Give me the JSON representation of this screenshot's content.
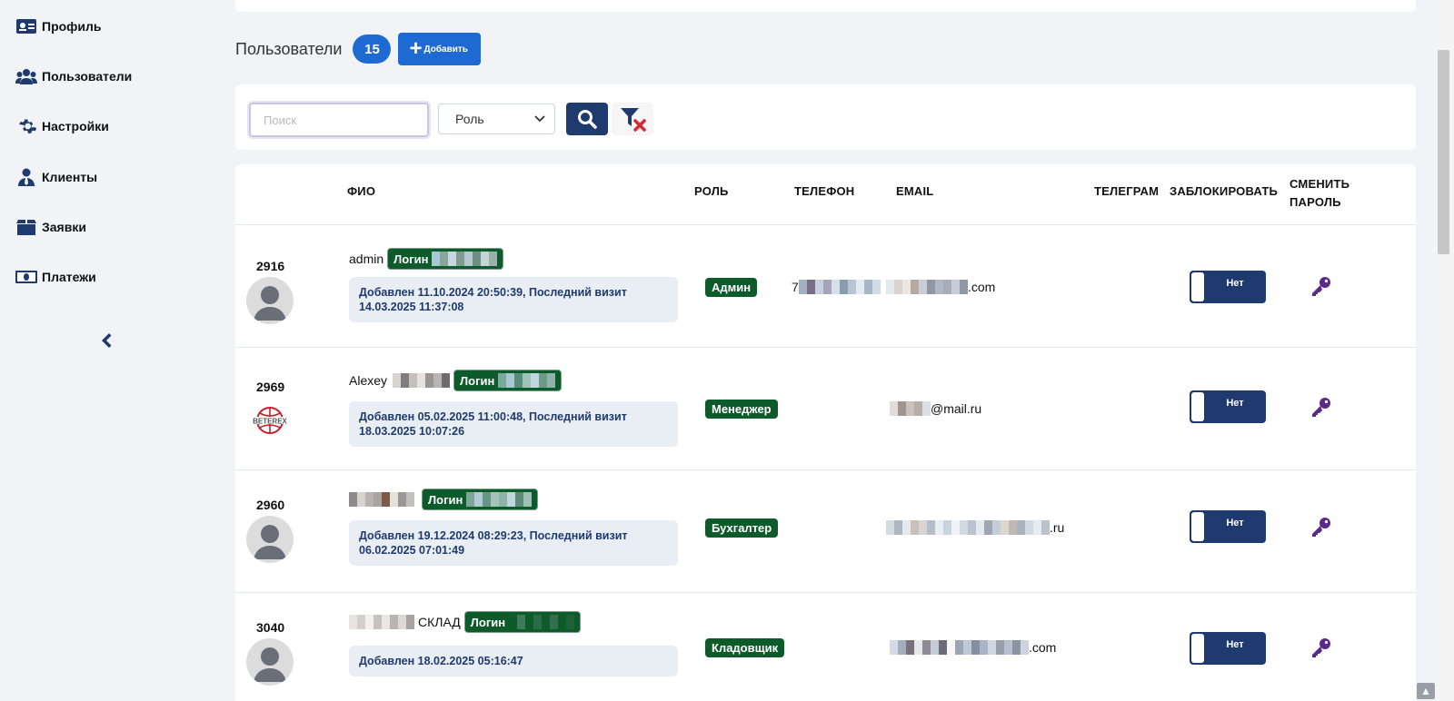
{
  "sidebar": {
    "items": [
      {
        "label": "Профиль",
        "icon": "id-card-icon"
      },
      {
        "label": "Пользователи",
        "icon": "users-icon"
      },
      {
        "label": "Настройки",
        "icon": "gear-icon"
      },
      {
        "label": "Клиенты",
        "icon": "user-tie-icon"
      },
      {
        "label": "Заявки",
        "icon": "box-icon"
      },
      {
        "label": "Платежи",
        "icon": "money-bill-icon"
      }
    ],
    "collapse_icon": "chevron-left-icon"
  },
  "header": {
    "title": "Пользователи",
    "count": "15",
    "add_label": "Добавить"
  },
  "filters": {
    "search_placeholder": "Поиск",
    "role_selected": "Роль"
  },
  "table": {
    "columns": {
      "fio": "ФИО",
      "role": "РОЛЬ",
      "phone": "ТЕЛЕФОН",
      "email": "EMAIL",
      "telegram": "ТЕЛЕГРАМ",
      "block": "ЗАБЛОКИРОВАТЬ",
      "change_password_1": "СМЕНИТЬ",
      "change_password_2": "ПАРОЛЬ"
    },
    "rows": [
      {
        "id": "2916",
        "name": "admin",
        "login_label": "Логин",
        "info_line1": "Добавлен 11.10.2024 20:50:39, Последний визит",
        "info_line2": "14.03.2025 11:37:08",
        "role": "Админ",
        "phone_prefix": "7",
        "email_suffix": ".com",
        "block_label": "Нет"
      },
      {
        "id": "2969",
        "name": "Alexey",
        "login_label": "Логин",
        "info_line1": "Добавлен 05.02.2025 11:00:48, Последний визит",
        "info_line2": "18.03.2025 10:07:26",
        "role": "Менеджер",
        "avatar_logo_text": "BETEREX",
        "email_suffix": "@mail.ru",
        "block_label": "Нет"
      },
      {
        "id": "2960",
        "name": "",
        "login_label": "Логин",
        "info_line1": "Добавлен 19.12.2024 08:29:23, Последний визит",
        "info_line2": "06.02.2025 07:01:49",
        "role": "Бухгалтер",
        "email_suffix": ".ru",
        "block_label": "Нет"
      },
      {
        "id": "3040",
        "name": "СКЛАД",
        "login_label": "Логин",
        "info_line1": "Добавлен 18.02.2025 05:16:47",
        "info_line2": "",
        "role": "Кладовщик",
        "email_suffix": ".com",
        "block_label": "Нет"
      }
    ]
  },
  "colors": {
    "primary": "#1e6ad3",
    "navy": "#1f3a6e",
    "badge_green": "#0d5a2a",
    "key_purple": "#5a2a8a",
    "background": "#f1f3f7"
  }
}
